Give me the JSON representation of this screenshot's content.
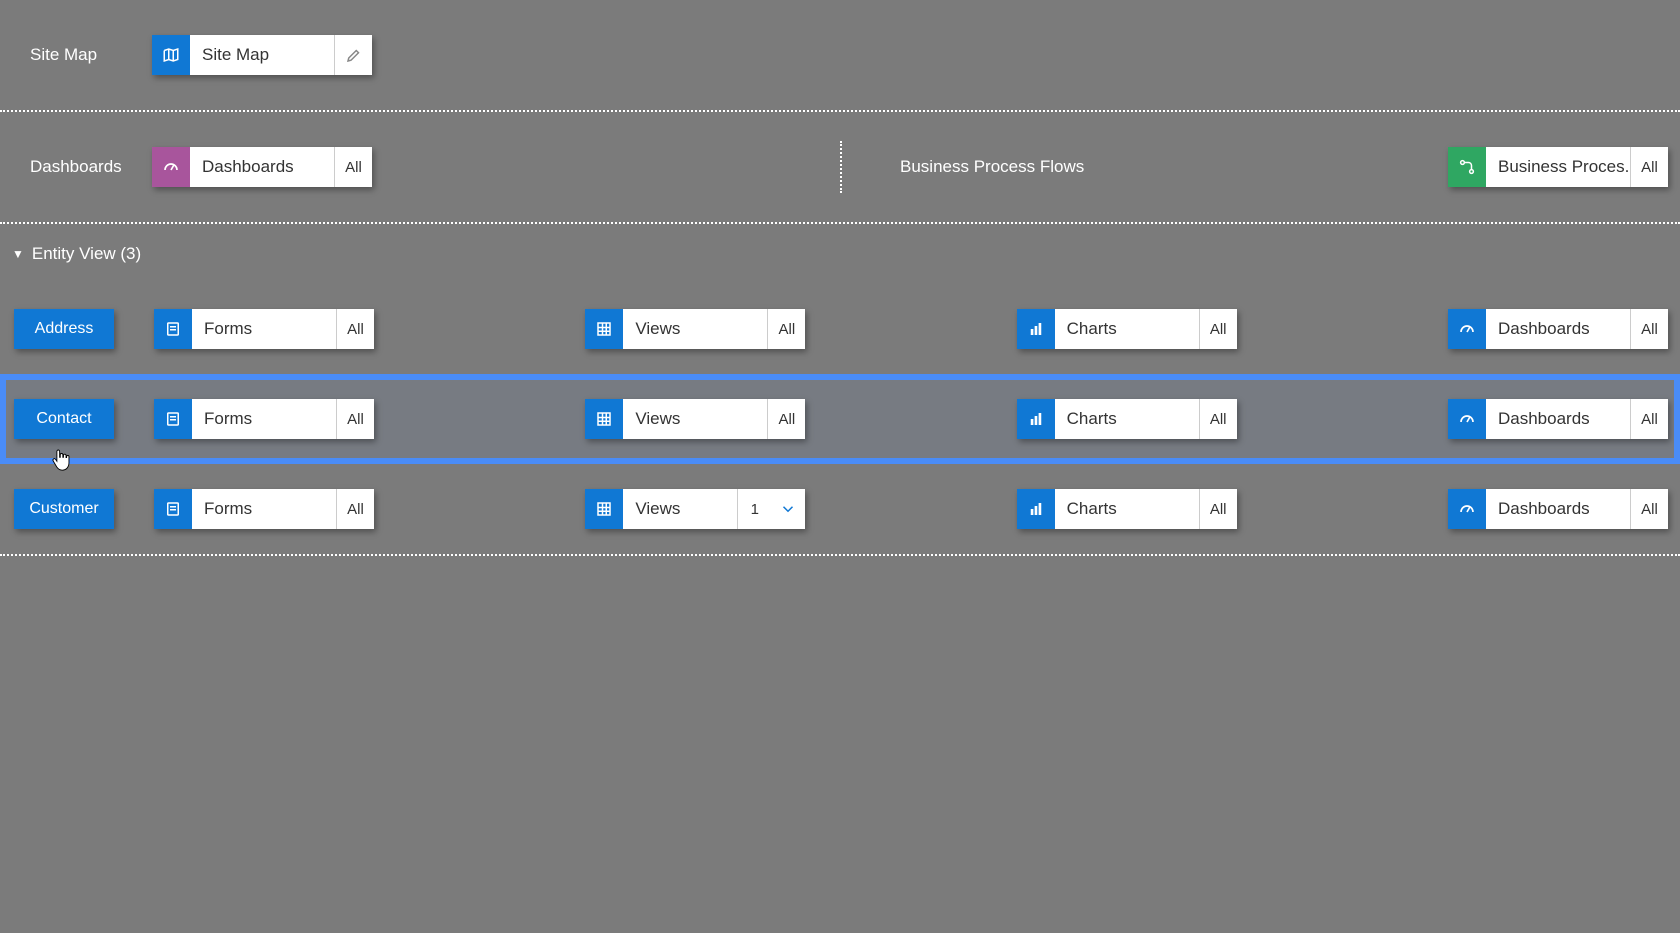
{
  "sitemap": {
    "label": "Site Map",
    "tile_label": "Site Map"
  },
  "dashboards_row": {
    "label": "Dashboards",
    "tile_label": "Dashboards",
    "badge": "All"
  },
  "bpf_row": {
    "label": "Business Process Flows",
    "tile_label": "Business Proces...",
    "badge": "All"
  },
  "entity_view": {
    "header": "Entity View (3)",
    "components": {
      "forms": "Forms",
      "views": "Views",
      "charts": "Charts",
      "dashboards": "Dashboards",
      "badge_all": "All"
    },
    "entities": [
      {
        "name": "Address",
        "selected": false,
        "views_mode": "all"
      },
      {
        "name": "Contact",
        "selected": true,
        "views_mode": "all"
      },
      {
        "name": "Customer",
        "selected": false,
        "views_mode": "count",
        "views_count": "1"
      }
    ]
  }
}
